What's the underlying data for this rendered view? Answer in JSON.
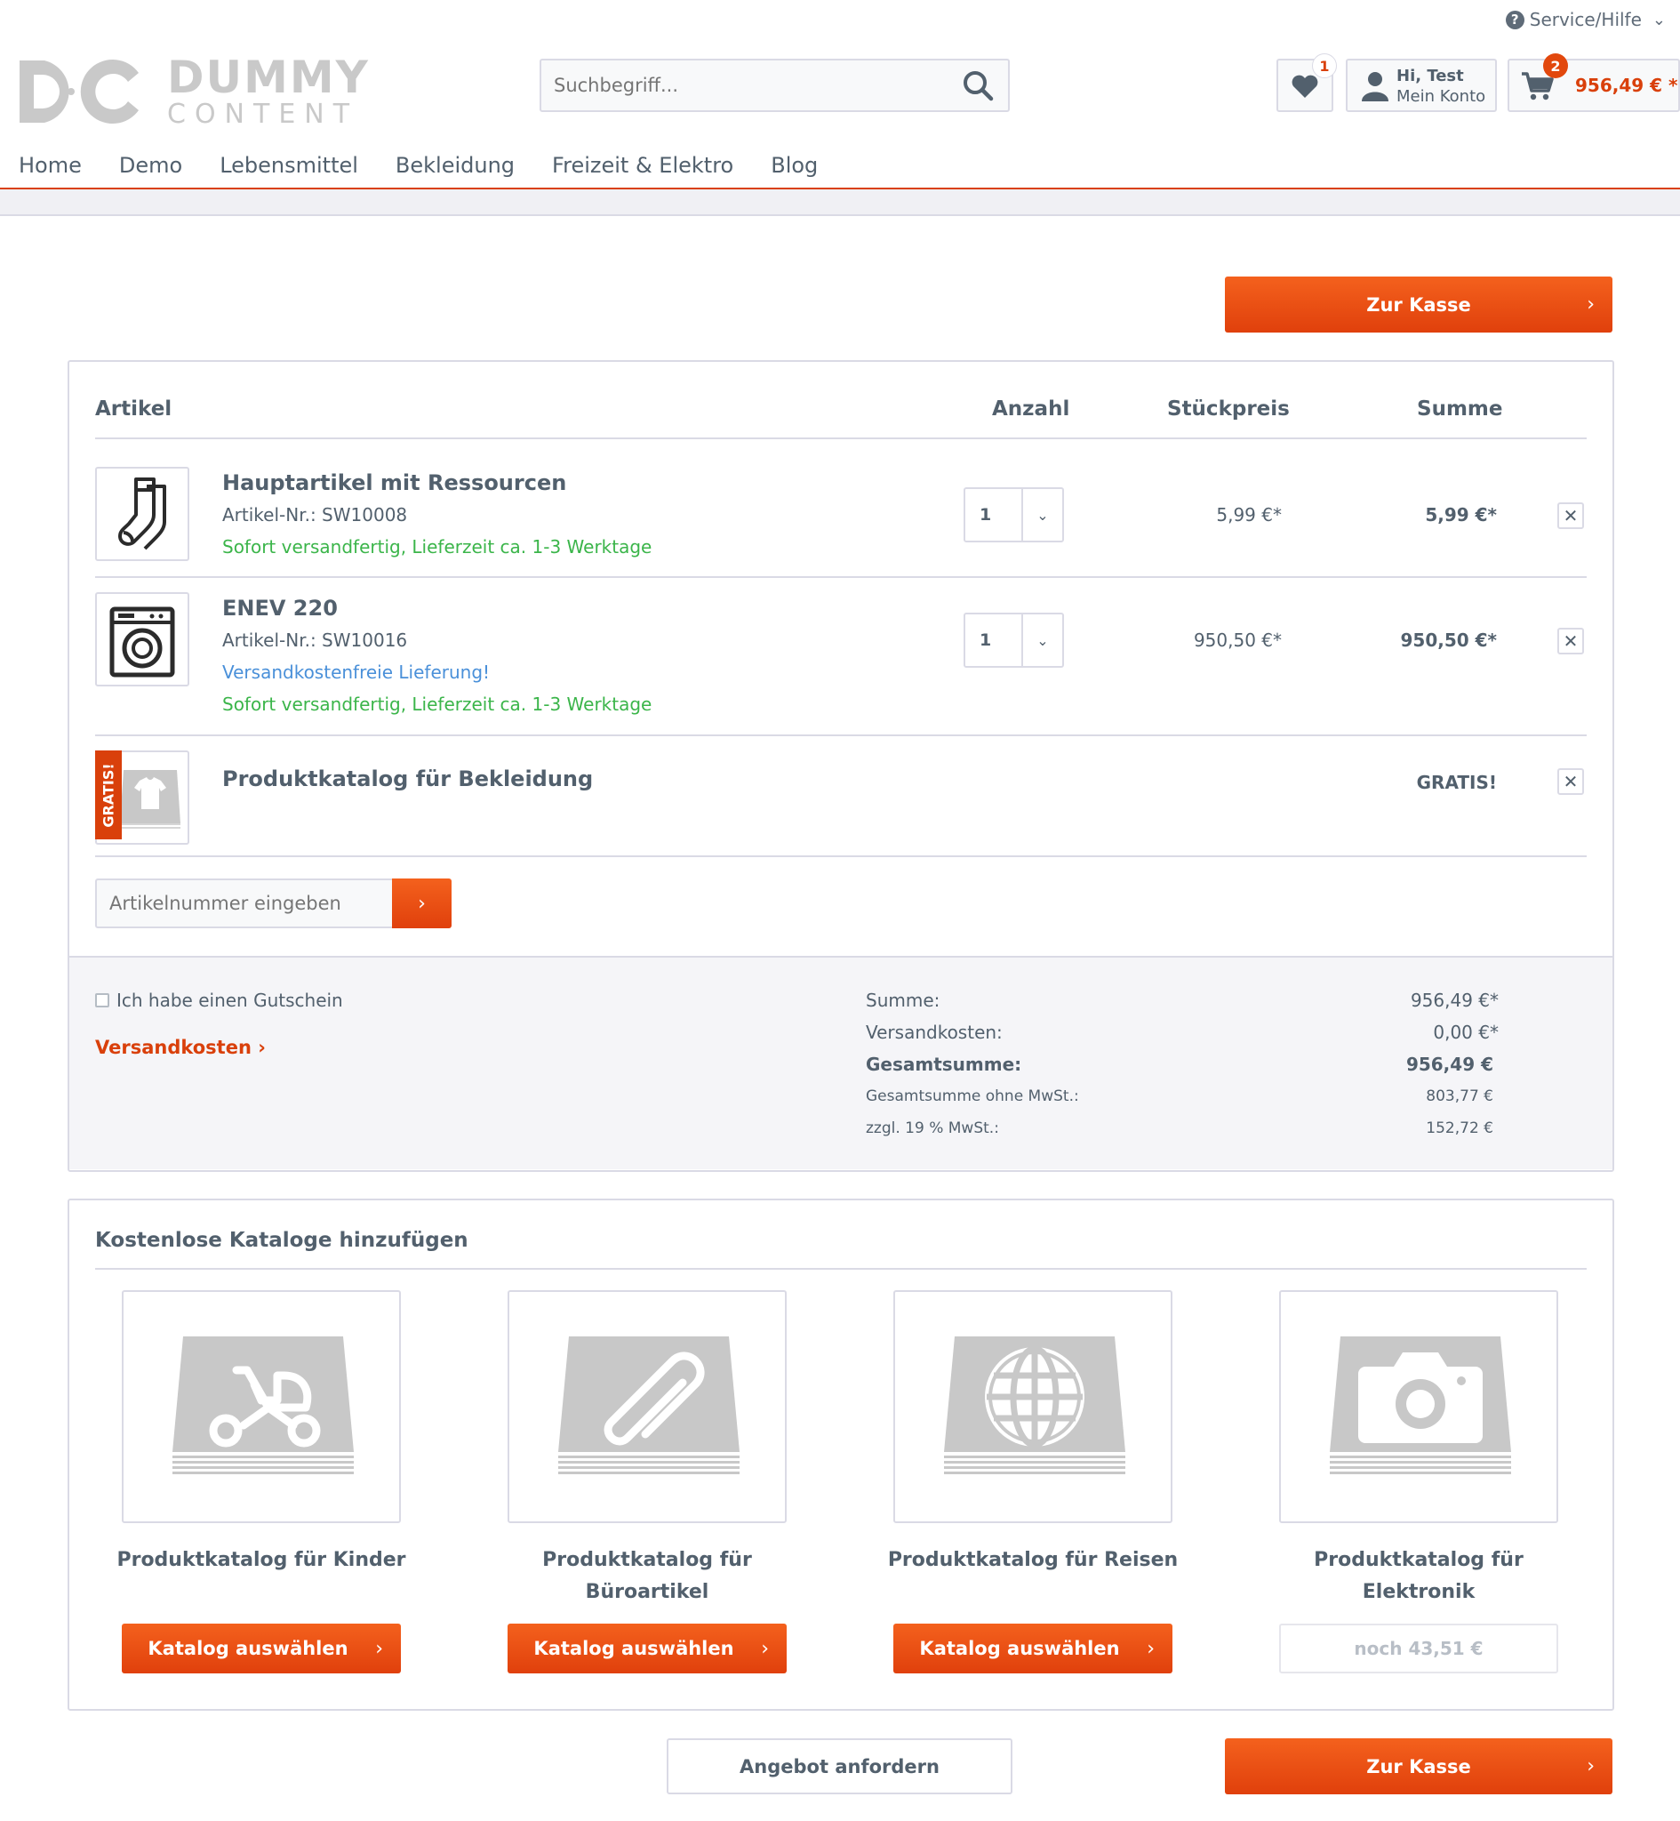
{
  "header": {
    "service_label": "Service/Hilfe",
    "logo": {
      "line1": "DUMMY",
      "line2": "CONTENT"
    },
    "search_placeholder": "Suchbegriff...",
    "wishlist_count": "1",
    "account_greeting": "Hi, Test",
    "account_label": "Mein Konto",
    "cart_count": "2",
    "cart_total": "956,49 € *"
  },
  "nav": {
    "items": [
      {
        "label": "Home"
      },
      {
        "label": "Demo"
      },
      {
        "label": "Lebensmittel"
      },
      {
        "label": "Bekleidung"
      },
      {
        "label": "Freizeit & Elektro"
      },
      {
        "label": "Blog"
      }
    ]
  },
  "checkout_label": "Zur Kasse",
  "cart": {
    "columns": {
      "article": "Artikel",
      "quantity": "Anzahl",
      "unit_price": "Stückpreis",
      "total": "Summe"
    },
    "items": [
      {
        "name": "Hauptartikel mit Ressourcen",
        "sku": "Artikel-Nr.: SW10008",
        "delivery": "Sofort versandfertig, Lieferzeit ca. 1-3 Werktage",
        "qty": "1",
        "unit_price": "5,99 €*",
        "total": "5,99 €*",
        "icon": "socks-icon"
      },
      {
        "name": "ENEV 220",
        "sku": "Artikel-Nr.: SW10016",
        "shipping_note": "Versandkostenfreie Lieferung!",
        "delivery": "Sofort versandfertig, Lieferzeit ca. 1-3 Werktage",
        "qty": "1",
        "unit_price": "950,50 €*",
        "total": "950,50 €*",
        "icon": "washing-machine-icon"
      },
      {
        "name": "Produktkatalog für Bekleidung",
        "badge": "GRATIS!",
        "total": "GRATIS!",
        "icon": "tshirt-catalog-icon"
      }
    ],
    "article_input_placeholder": "Artikelnummer eingeben"
  },
  "summary": {
    "voucher_label": "Ich habe einen Gutschein",
    "shipping_link": "Versandkosten",
    "rows": [
      {
        "label": "Summe:",
        "value": "956,49 €*"
      },
      {
        "label": "Versandkosten:",
        "value": "0,00 €*"
      },
      {
        "label": "Gesamtsumme:",
        "value": "956,49 €"
      },
      {
        "label": "Gesamtsumme ohne MwSt.:",
        "value": "803,77 €"
      },
      {
        "label": "zzgl. 19 % MwSt.:",
        "value": "152,72 €"
      }
    ]
  },
  "catalogs": {
    "heading": "Kostenlose Kataloge hinzufügen",
    "items": [
      {
        "title": "Produktkatalog für Kinder",
        "button": "Katalog auswählen",
        "icon": "stroller-icon"
      },
      {
        "title": "Produktkatalog für Büroartikel",
        "button": "Katalog auswählen",
        "icon": "paperclip-icon"
      },
      {
        "title": "Produktkatalog für Reisen",
        "button": "Katalog auswählen",
        "icon": "globe-icon"
      },
      {
        "title": "Produktkatalog für Elektronik",
        "button": "noch 43,51 €",
        "icon": "camera-icon"
      }
    ]
  },
  "offer_button": "Angebot anfordern",
  "colors": {
    "accent": "#e2480d",
    "text": "#52606d",
    "green": "#3bb54a",
    "blue": "#4a90d9",
    "border": "#dadae5"
  }
}
